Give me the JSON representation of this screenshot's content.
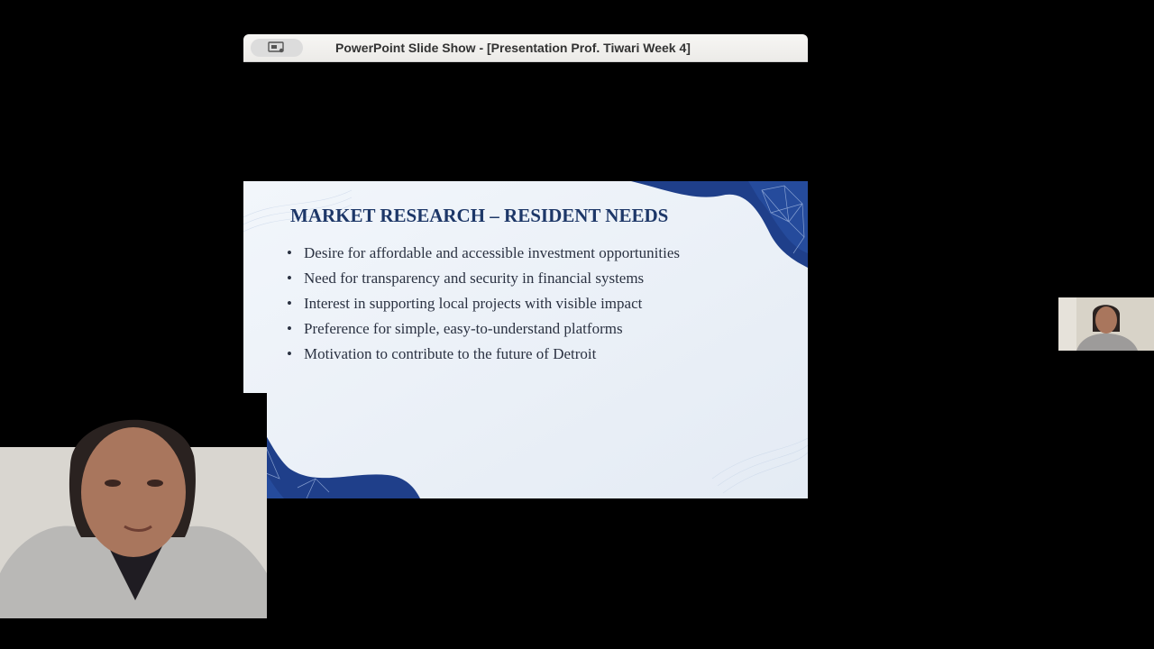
{
  "window": {
    "title": "PowerPoint Slide Show - [Presentation Prof. Tiwari Week 4]",
    "title_icon": "presenter-view-icon"
  },
  "slide": {
    "heading": "MARKET RESEARCH – RESIDENT NEEDS",
    "bullet_char": "•",
    "bullets": [
      "Desire for affordable and accessible investment opportunities",
      "Need for transparency and security in financial systems",
      "Interest in supporting local projects with visible impact",
      "Preference for simple, easy-to-understand platforms",
      "Motivation to contribute to the future of Detroit"
    ],
    "colors": {
      "background": "#eaf0f7",
      "accent": "#1f3f8a",
      "heading": "#1d3768"
    }
  },
  "participants": {
    "presenter_video": "presenter-video",
    "self_video": "self-view-video"
  }
}
